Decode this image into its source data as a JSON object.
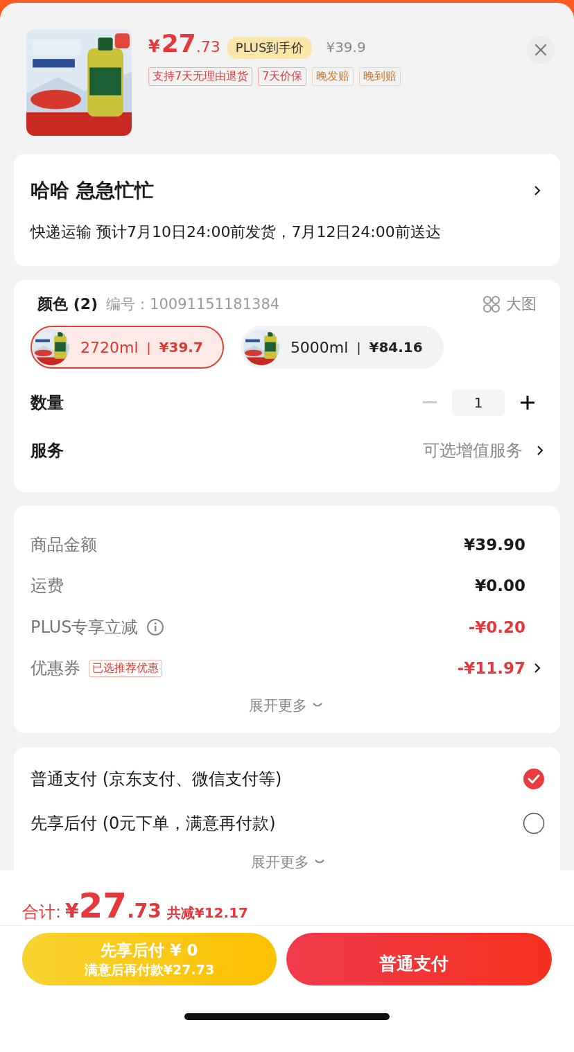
{
  "product": {
    "currency": "¥",
    "price_integer": "27",
    "price_decimal": ".73",
    "plus_badge": "PLUS到手价",
    "original_price": "¥39.9",
    "tags": [
      {
        "text": "支持7天无理由退货",
        "kind": "red"
      },
      {
        "text": "7天价保",
        "kind": "red"
      },
      {
        "text": "晚发赔",
        "kind": "orange"
      },
      {
        "text": "晚到赔",
        "kind": "orange"
      }
    ]
  },
  "address": {
    "name": "哈哈  急急忙忙",
    "delivery": "快递运输 预计7月10日24:00前发货，7月12日24:00前送达"
  },
  "spec": {
    "label": "颜色 (2)",
    "separator": "|",
    "code": "编号：10091151181384",
    "big_image": "大图",
    "options": [
      {
        "label": "2720ml",
        "price": "¥39.7",
        "selected": true
      },
      {
        "label": "5000ml",
        "price": "¥84.16",
        "selected": false
      }
    ]
  },
  "quantity": {
    "label": "数量",
    "value": "1",
    "decrease_disabled": true
  },
  "service": {
    "label": "服务",
    "value": "可选增值服务"
  },
  "costs": {
    "rows": [
      {
        "label": "商品金额",
        "value": "¥39.90",
        "kind": "amount"
      },
      {
        "label": "运费",
        "value": "¥0.00",
        "kind": "amount"
      },
      {
        "label": "PLUS专享立减",
        "value": "-¥0.20",
        "kind": "plus_discount"
      },
      {
        "label": "优惠券",
        "badge": "已选推荐优惠",
        "value": "-¥11.97",
        "kind": "coupon"
      }
    ],
    "more": "展开更多"
  },
  "payment": {
    "options": [
      {
        "label": "普通支付 (京东支付、微信支付等)",
        "selected": true
      },
      {
        "label": "先享后付 (0元下单，满意再付款)",
        "selected": false
      }
    ],
    "more": "展开更多"
  },
  "summary": {
    "label": "合计:",
    "currency": "¥",
    "integer": "27",
    "decimal": ".73",
    "saved": "共减¥12.17"
  },
  "buttons": [
    {
      "kind": "later",
      "line1": "先享后付 ¥ 0",
      "line2": "满意后再付款¥27.73"
    },
    {
      "kind": "pay",
      "label": "普通支付"
    }
  ]
}
